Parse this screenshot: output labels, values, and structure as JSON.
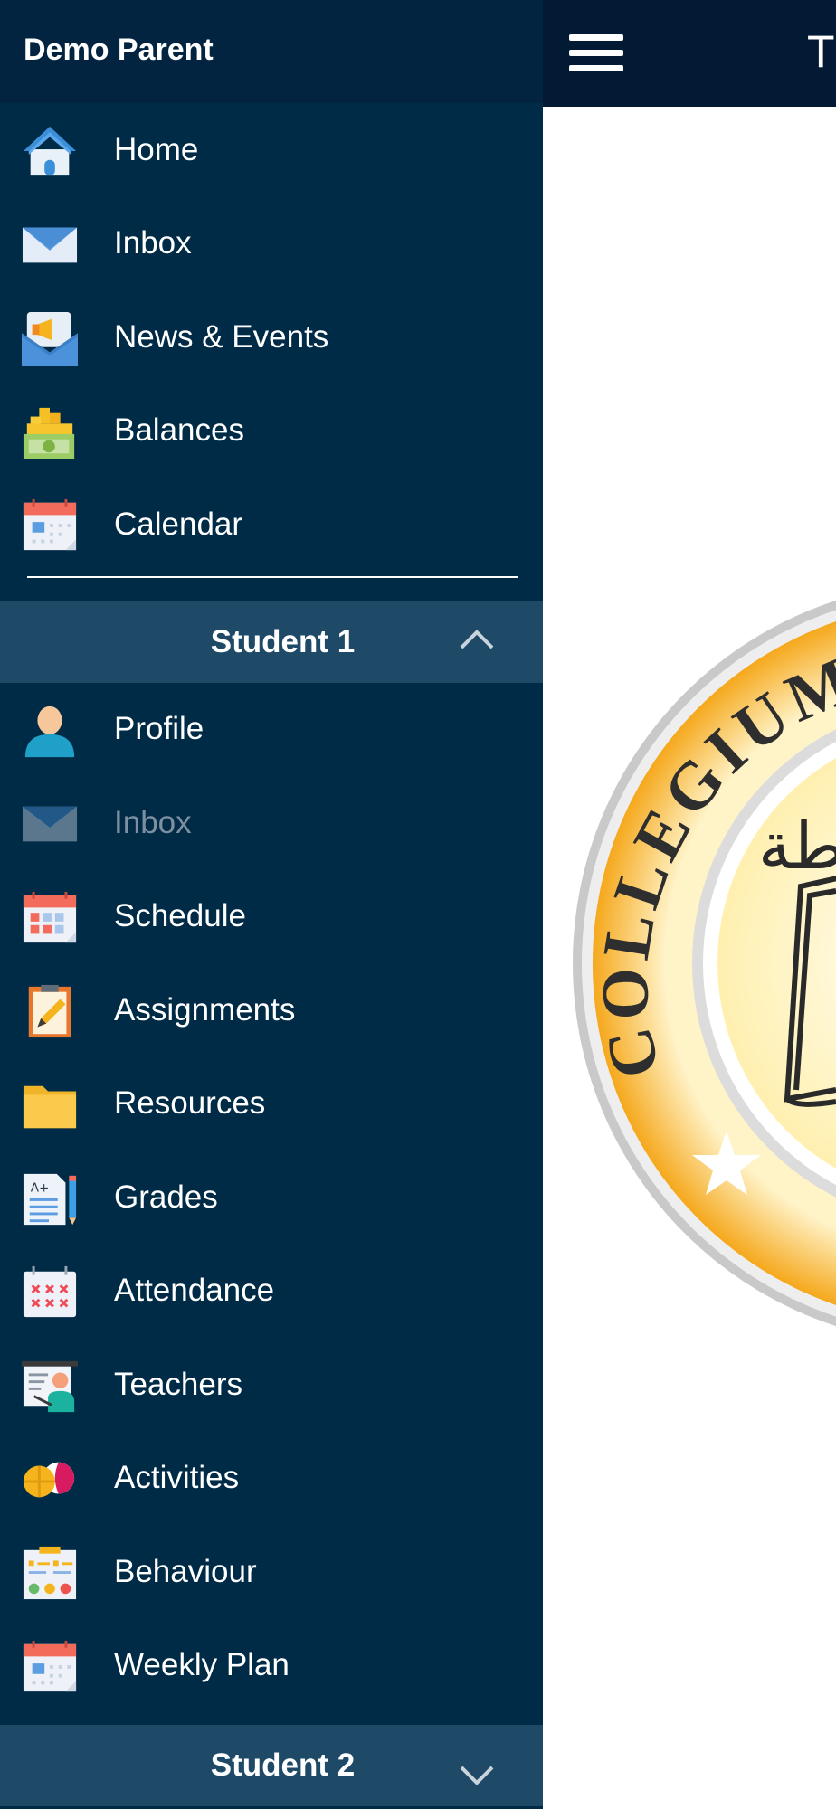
{
  "app": {
    "title_initial": "T",
    "menu_icon": "hamburger-icon"
  },
  "logo": {
    "text": "COLLEGIUM",
    "arabic_fragment": "طة",
    "colors": {
      "gold": "#f5a81c",
      "silver": "#b8b8b8"
    }
  },
  "drawer": {
    "user_name": "Demo Parent",
    "main_items": [
      {
        "label": "Home",
        "icon": "home-icon"
      },
      {
        "label": "Inbox",
        "icon": "envelope-icon"
      },
      {
        "label": "News & Events",
        "icon": "megaphone-icon"
      },
      {
        "label": "Balances",
        "icon": "money-icon"
      },
      {
        "label": "Calendar",
        "icon": "calendar-icon"
      }
    ],
    "student1": {
      "label": "Student 1",
      "expanded": true,
      "items": [
        {
          "label": "Profile",
          "icon": "profile-icon"
        },
        {
          "label": "Inbox",
          "icon": "envelope-icon",
          "disabled": true
        },
        {
          "label": "Schedule",
          "icon": "schedule-icon"
        },
        {
          "label": "Assignments",
          "icon": "clipboard-icon"
        },
        {
          "label": "Resources",
          "icon": "folder-icon"
        },
        {
          "label": "Grades",
          "icon": "grades-icon"
        },
        {
          "label": "Attendance",
          "icon": "attendance-icon"
        },
        {
          "label": "Teachers",
          "icon": "teacher-icon"
        },
        {
          "label": "Activities",
          "icon": "sports-balls-icon"
        },
        {
          "label": "Behaviour",
          "icon": "behaviour-icon"
        },
        {
          "label": "Weekly Plan",
          "icon": "calendar-icon"
        }
      ]
    },
    "student2": {
      "label": "Student 2",
      "expanded": false
    }
  },
  "colors": {
    "drawer_bg": "#002b47",
    "section_bg": "#1e4a68",
    "topbar_bg": "#021a33"
  }
}
